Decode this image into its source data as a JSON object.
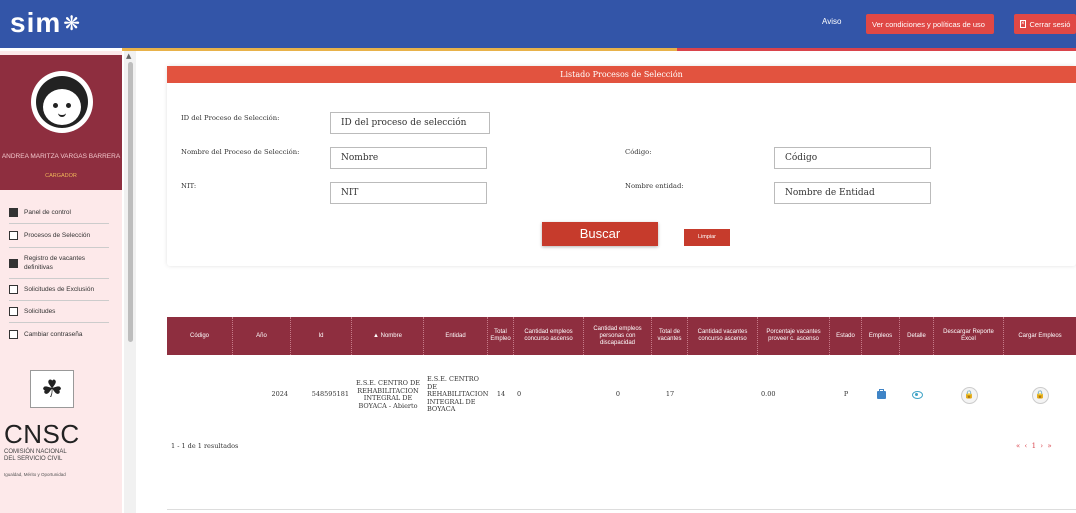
{
  "topbar": {
    "logo_text": "sim",
    "aviso": "Aviso",
    "condiciones": "Ver condiciones y políticas de uso",
    "cerrar": "Cerrar sesió",
    "colors": {
      "bar": "#3355a8",
      "button": "#e04845"
    }
  },
  "sidebar": {
    "user_name": "ANDREA MARITZA VARGAS BARRERA",
    "user_role": "CARGADOR",
    "items": [
      {
        "label": "Panel de control",
        "icon": "dashboard-icon"
      },
      {
        "label": "Procesos de Selección",
        "icon": "list-icon"
      },
      {
        "label": "Registro de vacantes definitivas",
        "icon": "briefcase-icon"
      },
      {
        "label": "Solicitudes de Exclusión",
        "icon": "list-icon"
      },
      {
        "label": "Solicitudes",
        "icon": "inbox-icon"
      },
      {
        "label": "Cambiar contraseña",
        "icon": "lock-icon"
      }
    ],
    "cnsc": {
      "title": "CNSC",
      "subtitle_1": "COMISIÓN NACIONAL",
      "subtitle_2": "DEL SERVICIO CIVIL",
      "slogan": "Igualdad, Mérito y Oportunidad"
    }
  },
  "panel": {
    "title": "Listado Procesos de Selección",
    "fields": {
      "id_label": "ID del Proceso de Selección:",
      "id_placeholder": "ID del proceso de selección",
      "nombre_label": "Nombre del Proceso de Selección:",
      "nombre_placeholder": "Nombre",
      "codigo_label": "Código:",
      "codigo_placeholder": "Código",
      "nit_label": "NIT:",
      "nit_placeholder": "NIT",
      "entidad_label": "Nombre entidad:",
      "entidad_placeholder": "Nombre de Entidad"
    },
    "buscar": "Buscar",
    "limpiar": "Limpiar"
  },
  "table": {
    "headers": [
      "Código",
      "Año",
      "Id",
      "▲ Nombre",
      "Entidad",
      "Total Empleo",
      "Cantidad empleos concurso ascenso",
      "Cantidad empleos personas con discapacidad",
      "Total de vacantes",
      "Cantidad vacantes concurso ascenso",
      "Porcentaje vacantes proveer c. ascenso",
      "Estado",
      "Empleos",
      "Detalle",
      "Descargar Reporte Excel",
      "Cargar Empleos"
    ],
    "row": {
      "codigo": "",
      "anio": "2024",
      "id": "548595181",
      "nombre": "E.S.E. CENTRO DE REHABILITACION INTEGRAL DE BOYACA - Abierto",
      "entidad": "E.S.E. CENTRO DE REHABILITACION INTEGRAL DE BOYACA",
      "total_empleo": "14",
      "empleos_ascenso": "0",
      "empleos_discapacidad": "0",
      "total_vacantes": "17",
      "vacantes_ascenso": "",
      "porcentaje": "0.00",
      "estado": "P"
    },
    "results_text": "1 - 1 de 1 resultados",
    "pager": {
      "first": "«",
      "prev": "‹",
      "page": "1",
      "next": "›",
      "last": "»"
    }
  }
}
